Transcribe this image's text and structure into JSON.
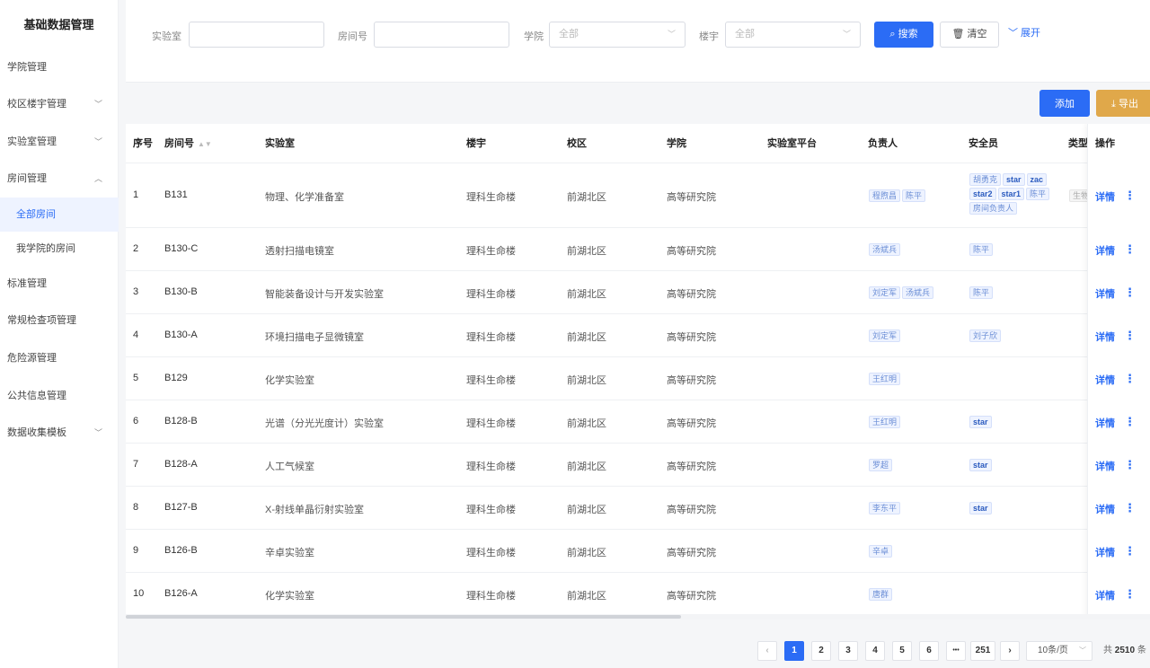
{
  "sidebar": {
    "title": "基础数据管理",
    "items": [
      {
        "label": "学院管理",
        "chevron": ""
      },
      {
        "label": "校区楼宇管理",
        "chevron": "﹀"
      },
      {
        "label": "实验室管理",
        "chevron": "﹀"
      },
      {
        "label": "房间管理",
        "chevron": "︿"
      },
      {
        "label": "全部房间",
        "chevron": ""
      },
      {
        "label": "我学院的房间",
        "chevron": ""
      },
      {
        "label": "标准管理",
        "chevron": ""
      },
      {
        "label": "常规检查项管理",
        "chevron": ""
      },
      {
        "label": "危险源管理",
        "chevron": ""
      },
      {
        "label": "公共信息管理",
        "chevron": ""
      },
      {
        "label": "数据收集模板",
        "chevron": "﹀"
      }
    ]
  },
  "filter": {
    "lab_label": "实验室",
    "room_label": "房间号",
    "college_label": "学院",
    "college_placeholder": "全部",
    "building_label": "楼宇",
    "building_placeholder": "全部",
    "search_label": "搜索",
    "clear_label": "清空",
    "expand_label": "展开"
  },
  "toolbar": {
    "add_label": "添加",
    "export_label": "导出"
  },
  "table": {
    "headers": {
      "index": "序号",
      "room": "房间号",
      "lab": "实验室",
      "building": "楼宇",
      "campus": "校区",
      "college": "学院",
      "platform": "实验室平台",
      "owner": "负责人",
      "safety": "安全员",
      "type": "类型",
      "ops": "操作"
    },
    "detail_label": "详情",
    "more_label": "⋮",
    "rows": [
      {
        "index": "1",
        "room": "B131",
        "lab": "物理、化学准备室",
        "building": "理科生命楼",
        "campus": "前湖北区",
        "college": "高等研究院",
        "owners": [
          "程煦昌",
          "陈平"
        ],
        "safety": [
          "胡勇克",
          "star",
          "zac",
          "star2",
          "star1",
          "陈平",
          "房间负责人"
        ],
        "type": "生物"
      },
      {
        "index": "2",
        "room": "B130-C",
        "lab": "透射扫描电镜室",
        "building": "理科生命楼",
        "campus": "前湖北区",
        "college": "高等研究院",
        "owners": [
          "汤斌兵"
        ],
        "safety": [
          "陈平"
        ],
        "type": ""
      },
      {
        "index": "3",
        "room": "B130-B",
        "lab": "智能装备设计与开发实验室",
        "building": "理科生命楼",
        "campus": "前湖北区",
        "college": "高等研究院",
        "owners": [
          "刘定军",
          "汤斌兵"
        ],
        "safety": [
          "陈平"
        ],
        "type": ""
      },
      {
        "index": "4",
        "room": "B130-A",
        "lab": "环境扫描电子显微镜室",
        "building": "理科生命楼",
        "campus": "前湖北区",
        "college": "高等研究院",
        "owners": [
          "刘定军"
        ],
        "safety": [
          "刘子欣"
        ],
        "type": ""
      },
      {
        "index": "5",
        "room": "B129",
        "lab": "化学实验室",
        "building": "理科生命楼",
        "campus": "前湖北区",
        "college": "高等研究院",
        "owners": [
          "王红明"
        ],
        "safety": [],
        "type": ""
      },
      {
        "index": "6",
        "room": "B128-B",
        "lab": "光谱（分光光度计）实验室",
        "building": "理科生命楼",
        "campus": "前湖北区",
        "college": "高等研究院",
        "owners": [
          "王红明"
        ],
        "safety": [
          "star"
        ],
        "type": ""
      },
      {
        "index": "7",
        "room": "B128-A",
        "lab": "人工气候室",
        "building": "理科生命楼",
        "campus": "前湖北区",
        "college": "高等研究院",
        "owners": [
          "罗超"
        ],
        "safety": [
          "star"
        ],
        "type": ""
      },
      {
        "index": "8",
        "room": "B127-B",
        "lab": "X-射线单晶衍射实验室",
        "building": "理科生命楼",
        "campus": "前湖北区",
        "college": "高等研究院",
        "owners": [
          "李东平"
        ],
        "safety": [
          "star"
        ],
        "type": ""
      },
      {
        "index": "9",
        "room": "B126-B",
        "lab": "辛卓实验室",
        "building": "理科生命楼",
        "campus": "前湖北区",
        "college": "高等研究院",
        "owners": [
          "辛卓"
        ],
        "safety": [],
        "type": ""
      },
      {
        "index": "10",
        "room": "B126-A",
        "lab": "化学实验室",
        "building": "理科生命楼",
        "campus": "前湖北区",
        "college": "高等研究院",
        "owners": [
          "唐群"
        ],
        "safety": [],
        "type": ""
      }
    ]
  },
  "pagination": {
    "prev": "‹",
    "pages": [
      "1",
      "2",
      "3",
      "4",
      "5",
      "6",
      "•••",
      "251"
    ],
    "next": "›",
    "page_size": "10条/页",
    "total_prefix": "共",
    "total": "2510",
    "total_suffix": "条"
  }
}
